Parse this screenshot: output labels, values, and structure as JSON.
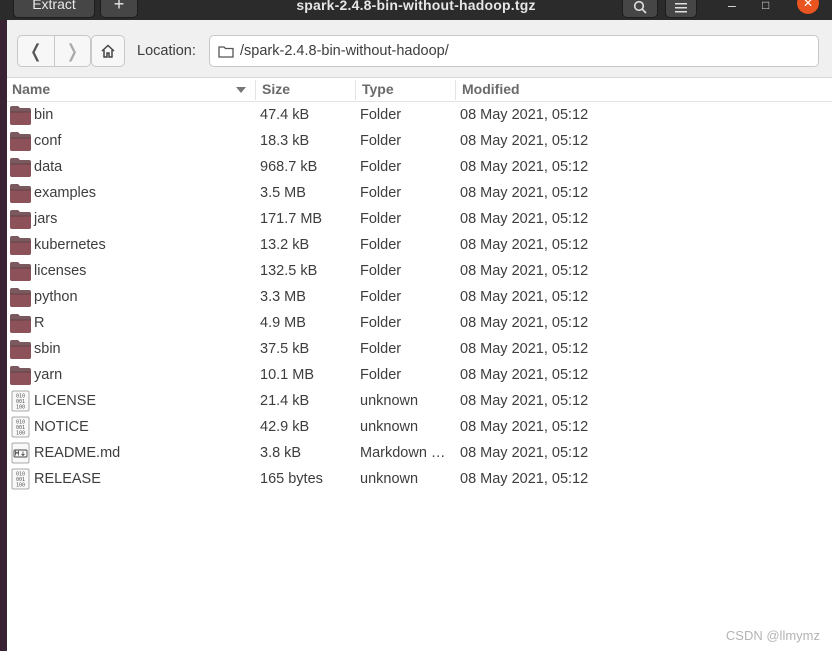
{
  "window": {
    "title": "spark-2.4.8-bin-without-hadoop.tgz",
    "extract_label": "Extract",
    "add_label": "+",
    "search_icon": "search-icon",
    "menu_icon": "hamburger-menu-icon",
    "minimize_label": "–",
    "maximize_label": "□",
    "close_label": "✕"
  },
  "toolbar": {
    "back_label": "❬",
    "forward_label": "❭",
    "home_icon": "home-icon",
    "location_label": "Location:",
    "location_value": "/spark-2.4.8-bin-without-hadoop/"
  },
  "columns": {
    "name": "Name",
    "size": "Size",
    "type": "Type",
    "modified": "Modified"
  },
  "files": [
    {
      "name": "bin",
      "size": "47.4 kB",
      "type": "Folder",
      "modified": "08 May 2021, 05:12",
      "icon": "folder-icon"
    },
    {
      "name": "conf",
      "size": "18.3 kB",
      "type": "Folder",
      "modified": "08 May 2021, 05:12",
      "icon": "folder-icon"
    },
    {
      "name": "data",
      "size": "968.7 kB",
      "type": "Folder",
      "modified": "08 May 2021, 05:12",
      "icon": "folder-icon"
    },
    {
      "name": "examples",
      "size": "3.5 MB",
      "type": "Folder",
      "modified": "08 May 2021, 05:12",
      "icon": "folder-icon"
    },
    {
      "name": "jars",
      "size": "171.7 MB",
      "type": "Folder",
      "modified": "08 May 2021, 05:12",
      "icon": "folder-icon"
    },
    {
      "name": "kubernetes",
      "size": "13.2 kB",
      "type": "Folder",
      "modified": "08 May 2021, 05:12",
      "icon": "folder-icon"
    },
    {
      "name": "licenses",
      "size": "132.5 kB",
      "type": "Folder",
      "modified": "08 May 2021, 05:12",
      "icon": "folder-icon"
    },
    {
      "name": "python",
      "size": "3.3 MB",
      "type": "Folder",
      "modified": "08 May 2021, 05:12",
      "icon": "folder-icon"
    },
    {
      "name": "R",
      "size": "4.9 MB",
      "type": "Folder",
      "modified": "08 May 2021, 05:12",
      "icon": "folder-icon"
    },
    {
      "name": "sbin",
      "size": "37.5 kB",
      "type": "Folder",
      "modified": "08 May 2021, 05:12",
      "icon": "folder-icon"
    },
    {
      "name": "yarn",
      "size": "10.1 MB",
      "type": "Folder",
      "modified": "08 May 2021, 05:12",
      "icon": "folder-icon"
    },
    {
      "name": "LICENSE",
      "size": "21.4 kB",
      "type": "unknown",
      "modified": "08 May 2021, 05:12",
      "icon": "binary-file-icon"
    },
    {
      "name": "NOTICE",
      "size": "42.9 kB",
      "type": "unknown",
      "modified": "08 May 2021, 05:12",
      "icon": "binary-file-icon"
    },
    {
      "name": "README.md",
      "size": "3.8 kB",
      "type": "Markdown …",
      "modified": "08 May 2021, 05:12",
      "icon": "markdown-file-icon"
    },
    {
      "name": "RELEASE",
      "size": "165 bytes",
      "type": "unknown",
      "modified": "08 May 2021, 05:12",
      "icon": "binary-file-icon"
    }
  ],
  "watermark": "CSDN @llmymz",
  "colors": {
    "folder_body": "#7a5a5e",
    "folder_tab": "#9b4a55",
    "close_button": "#e95420",
    "headerbar": "#2b2b2b"
  }
}
